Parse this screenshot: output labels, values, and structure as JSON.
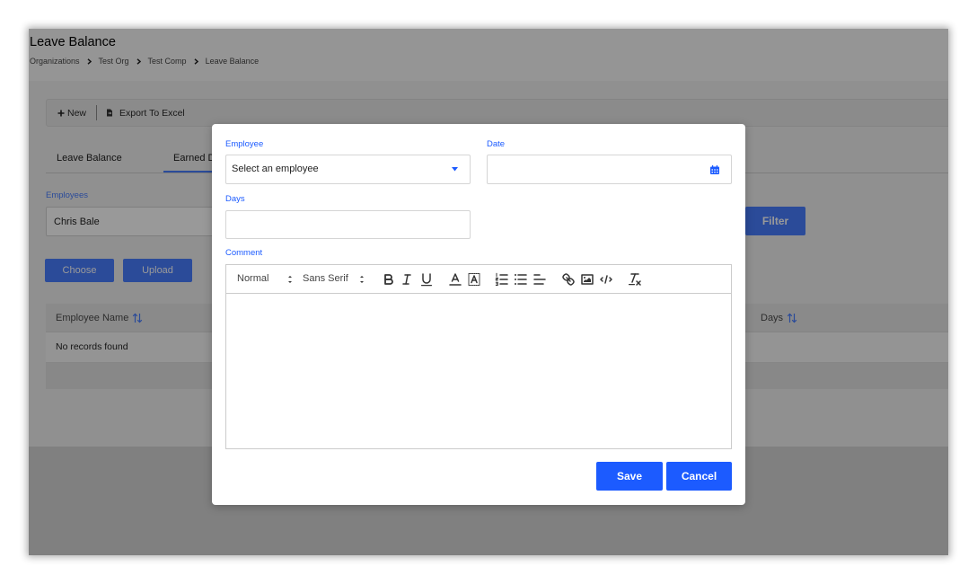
{
  "page": {
    "title": "Leave Balance",
    "breadcrumb": [
      "Organizations",
      "Test Org",
      "Test Comp",
      "Leave Balance"
    ],
    "toolbar": {
      "new_label": "New",
      "new_icon": "plus-icon",
      "export_label": "Export To Excel",
      "export_icon": "export-icon"
    },
    "tabs": [
      {
        "label": "Leave Balance",
        "active": false
      },
      {
        "label": "Earned D",
        "active": true
      }
    ],
    "filter": {
      "employees_label": "Employees",
      "employees_value": "Chris Bale",
      "filter_button": "Filter"
    },
    "upload": {
      "choose_label": "Choose",
      "upload_label": "Upload"
    },
    "table": {
      "columns": [
        "Employee Name",
        "Days"
      ],
      "sort_icon": "sort-icon",
      "empty_message": "No records found"
    }
  },
  "modal": {
    "employee": {
      "label": "Employee",
      "placeholder": "Select an employee",
      "icon": "caret-down-icon"
    },
    "date": {
      "label": "Date",
      "value": "",
      "icon": "calendar-icon"
    },
    "days": {
      "label": "Days",
      "value": ""
    },
    "comment": {
      "label": "Comment",
      "editor": {
        "header_picker": "Normal",
        "font_picker": "Sans Serif",
        "tools": [
          "bold-icon",
          "italic-icon",
          "underline-icon",
          "text-color-icon",
          "background-color-icon",
          "ordered-list-icon",
          "bullet-list-icon",
          "align-icon",
          "link-icon",
          "image-icon",
          "code-block-icon",
          "clear-format-icon"
        ]
      }
    },
    "save_label": "Save",
    "cancel_label": "Cancel"
  },
  "colors": {
    "modal_accent": "#1c5bff",
    "page_accent": "#487dff",
    "backdrop": "rgba(0,0,0,0.4)"
  }
}
